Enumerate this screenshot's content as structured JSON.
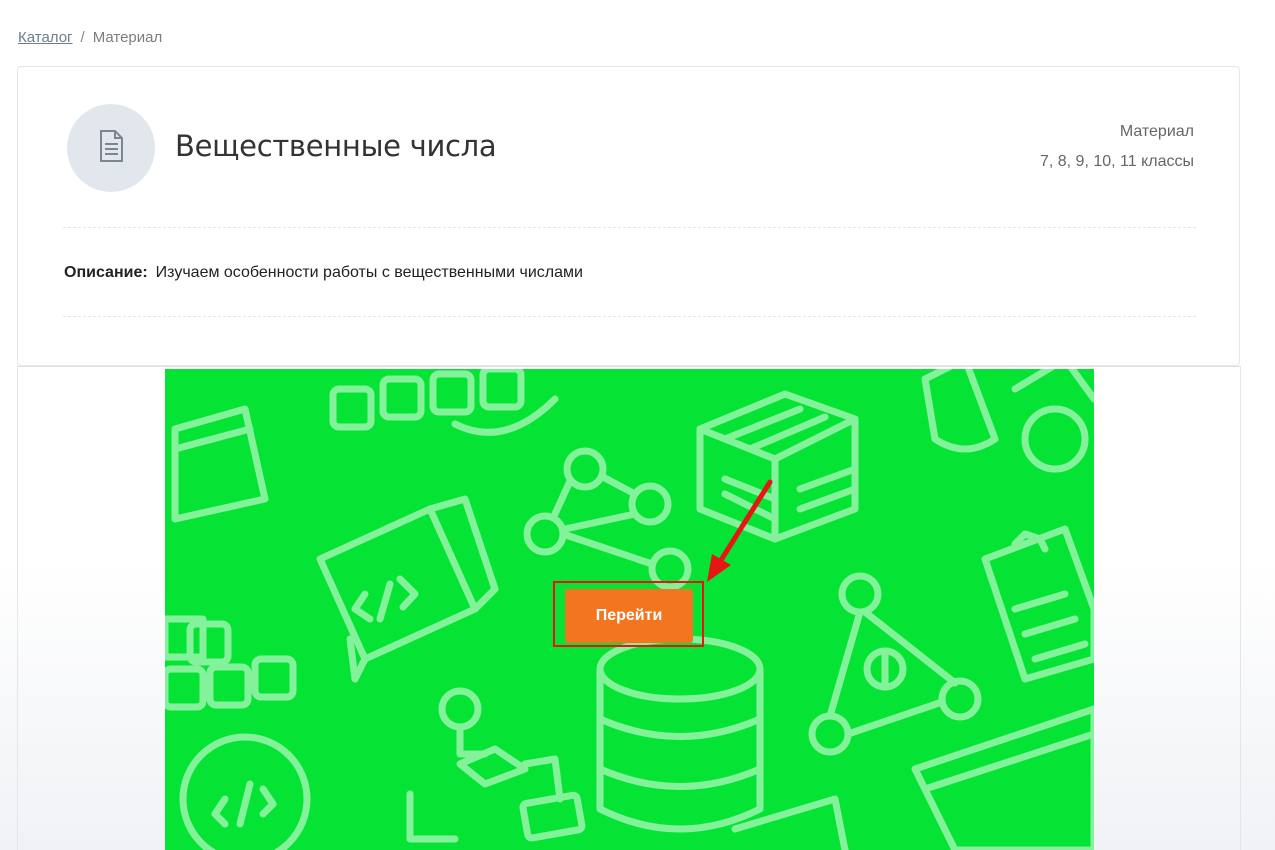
{
  "breadcrumb": {
    "catalog_label": "Каталог",
    "separator": "/",
    "current_label": "Материал"
  },
  "material": {
    "icon": "document-icon",
    "title": "Вещественные числа",
    "type": "Материал",
    "grades": "7, 8, 9, 10, 11 классы"
  },
  "description": {
    "label": "Описание:",
    "text": "Изучаем особенности работы с вещественными числами"
  },
  "cover": {
    "background_color": "#05e434",
    "button_label": "Перейти",
    "button_color": "#f4751f",
    "highlight_color": "#e81515"
  }
}
